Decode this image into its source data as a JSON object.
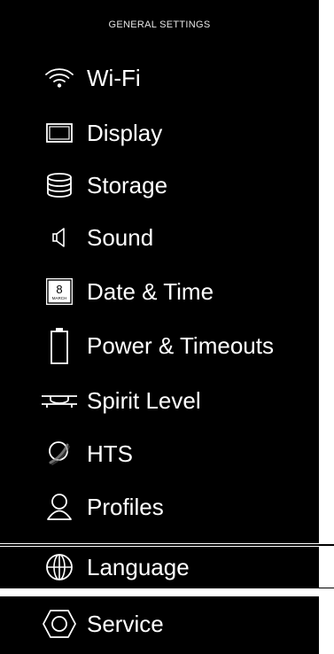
{
  "header": {
    "title": "GENERAL SETTINGS"
  },
  "menu": {
    "items": [
      {
        "label": "Wi-Fi",
        "icon": "wifi-icon"
      },
      {
        "label": "Display",
        "icon": "display-icon"
      },
      {
        "label": "Storage",
        "icon": "storage-icon"
      },
      {
        "label": "Sound",
        "icon": "speaker-icon"
      },
      {
        "label": "Date & Time",
        "icon": "calendar-icon",
        "icon_day": "8",
        "icon_month": "MARCH"
      },
      {
        "label": "Power & Timeouts",
        "icon": "battery-icon"
      },
      {
        "label": "Spirit Level",
        "icon": "spirit-level-icon"
      },
      {
        "label": "HTS",
        "icon": "hts-icon"
      },
      {
        "label": "Profiles",
        "icon": "profile-icon"
      },
      {
        "label": "Language",
        "icon": "globe-icon"
      },
      {
        "label": "Service",
        "icon": "hexagon-icon"
      }
    ]
  },
  "colors": {
    "background": "#000000",
    "text": "#ffffff",
    "page": "#ffffff"
  }
}
